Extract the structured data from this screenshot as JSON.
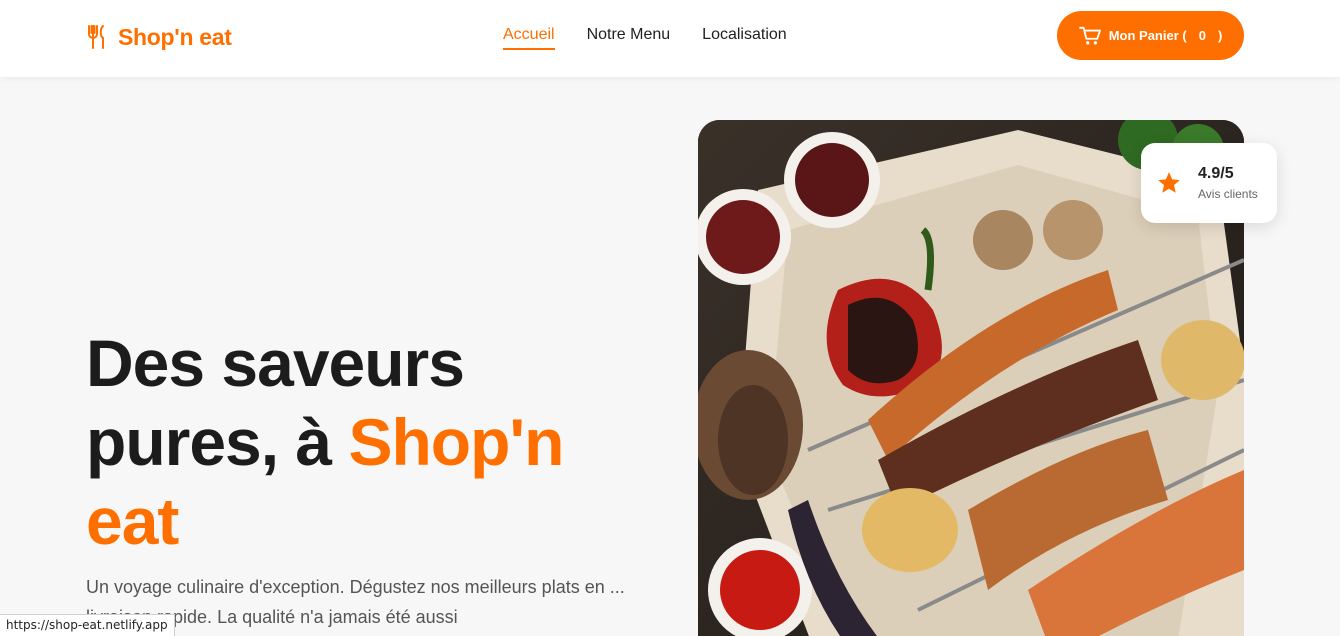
{
  "brand": {
    "name": "Shop'n eat",
    "icon": "fork-knife-icon",
    "color": "#ff6f00"
  },
  "nav": {
    "items": [
      {
        "label": "Accueil",
        "active": true
      },
      {
        "label": "Notre Menu",
        "active": false
      },
      {
        "label": "Localisation",
        "active": false
      }
    ]
  },
  "cart": {
    "label": "Mon Panier (",
    "count": "0",
    "close": ")",
    "icon": "cart-icon"
  },
  "hero": {
    "title_part1": "Des saveurs pures, à ",
    "title_accent": "Shop'n eat",
    "subtitle": "Un voyage culinaire d'exception. Dégustez nos meilleurs plats en ... livraison rapide. La qualité n'a jamais été aussi"
  },
  "rating": {
    "value": "4.9/5",
    "label": "Avis clients",
    "icon": "star-icon"
  },
  "status_bar": {
    "url": "https://shop-eat.netlify.app"
  },
  "colors": {
    "accent": "#ff6f00",
    "background": "#f7f7f7",
    "text": "#1f1f1f"
  }
}
